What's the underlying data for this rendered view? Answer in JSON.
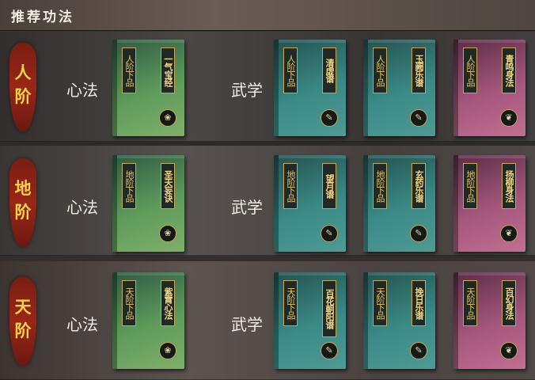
{
  "header": {
    "title": "推荐功法"
  },
  "rows": [
    {
      "tier": [
        "人",
        "阶"
      ],
      "xinfa_label": "心法",
      "wuxue_label": "武学",
      "books": [
        {
          "grade": "人阶下品",
          "name": "一气宝经",
          "icon": "lotus-emblem-icon"
        },
        {
          "grade": "人阶下品",
          "name": "清虚谱",
          "icon": "brush-emblem-icon"
        },
        {
          "grade": "人阶下品",
          "name": "玉阙乐谱",
          "icon": "brush-emblem-icon"
        },
        {
          "grade": "人阶下品",
          "name": "青鸣身法",
          "icon": "wings-emblem-icon"
        }
      ]
    },
    {
      "tier": [
        "地",
        "阶"
      ],
      "xinfa_label": "心法",
      "wuxue_label": "武学",
      "books": [
        {
          "grade": "地阶下品",
          "name": "圣天妄诀",
          "icon": "lotus-emblem-icon"
        },
        {
          "grade": "地阶下品",
          "name": "望月谱",
          "icon": "brush-emblem-icon"
        },
        {
          "grade": "地阶下品",
          "name": "玄药乐谱",
          "icon": "brush-emblem-icon"
        },
        {
          "grade": "地阶下品",
          "name": "扬柳身法",
          "icon": "wings-emblem-icon"
        }
      ]
    },
    {
      "tier": [
        "天",
        "阶"
      ],
      "xinfa_label": "心法",
      "wuxue_label": "武学",
      "books": [
        {
          "grade": "天阶下品",
          "name": "紫霄心法",
          "icon": "lotus-emblem-icon"
        },
        {
          "grade": "天阶下品",
          "name": "百花朝阳谱",
          "icon": "brush-emblem-icon"
        },
        {
          "grade": "天阶下品",
          "name": "挽日乐谱",
          "icon": "brush-emblem-icon"
        },
        {
          "grade": "天阶下品",
          "name": "百幻身法",
          "icon": "wings-emblem-icon"
        }
      ]
    }
  ]
}
